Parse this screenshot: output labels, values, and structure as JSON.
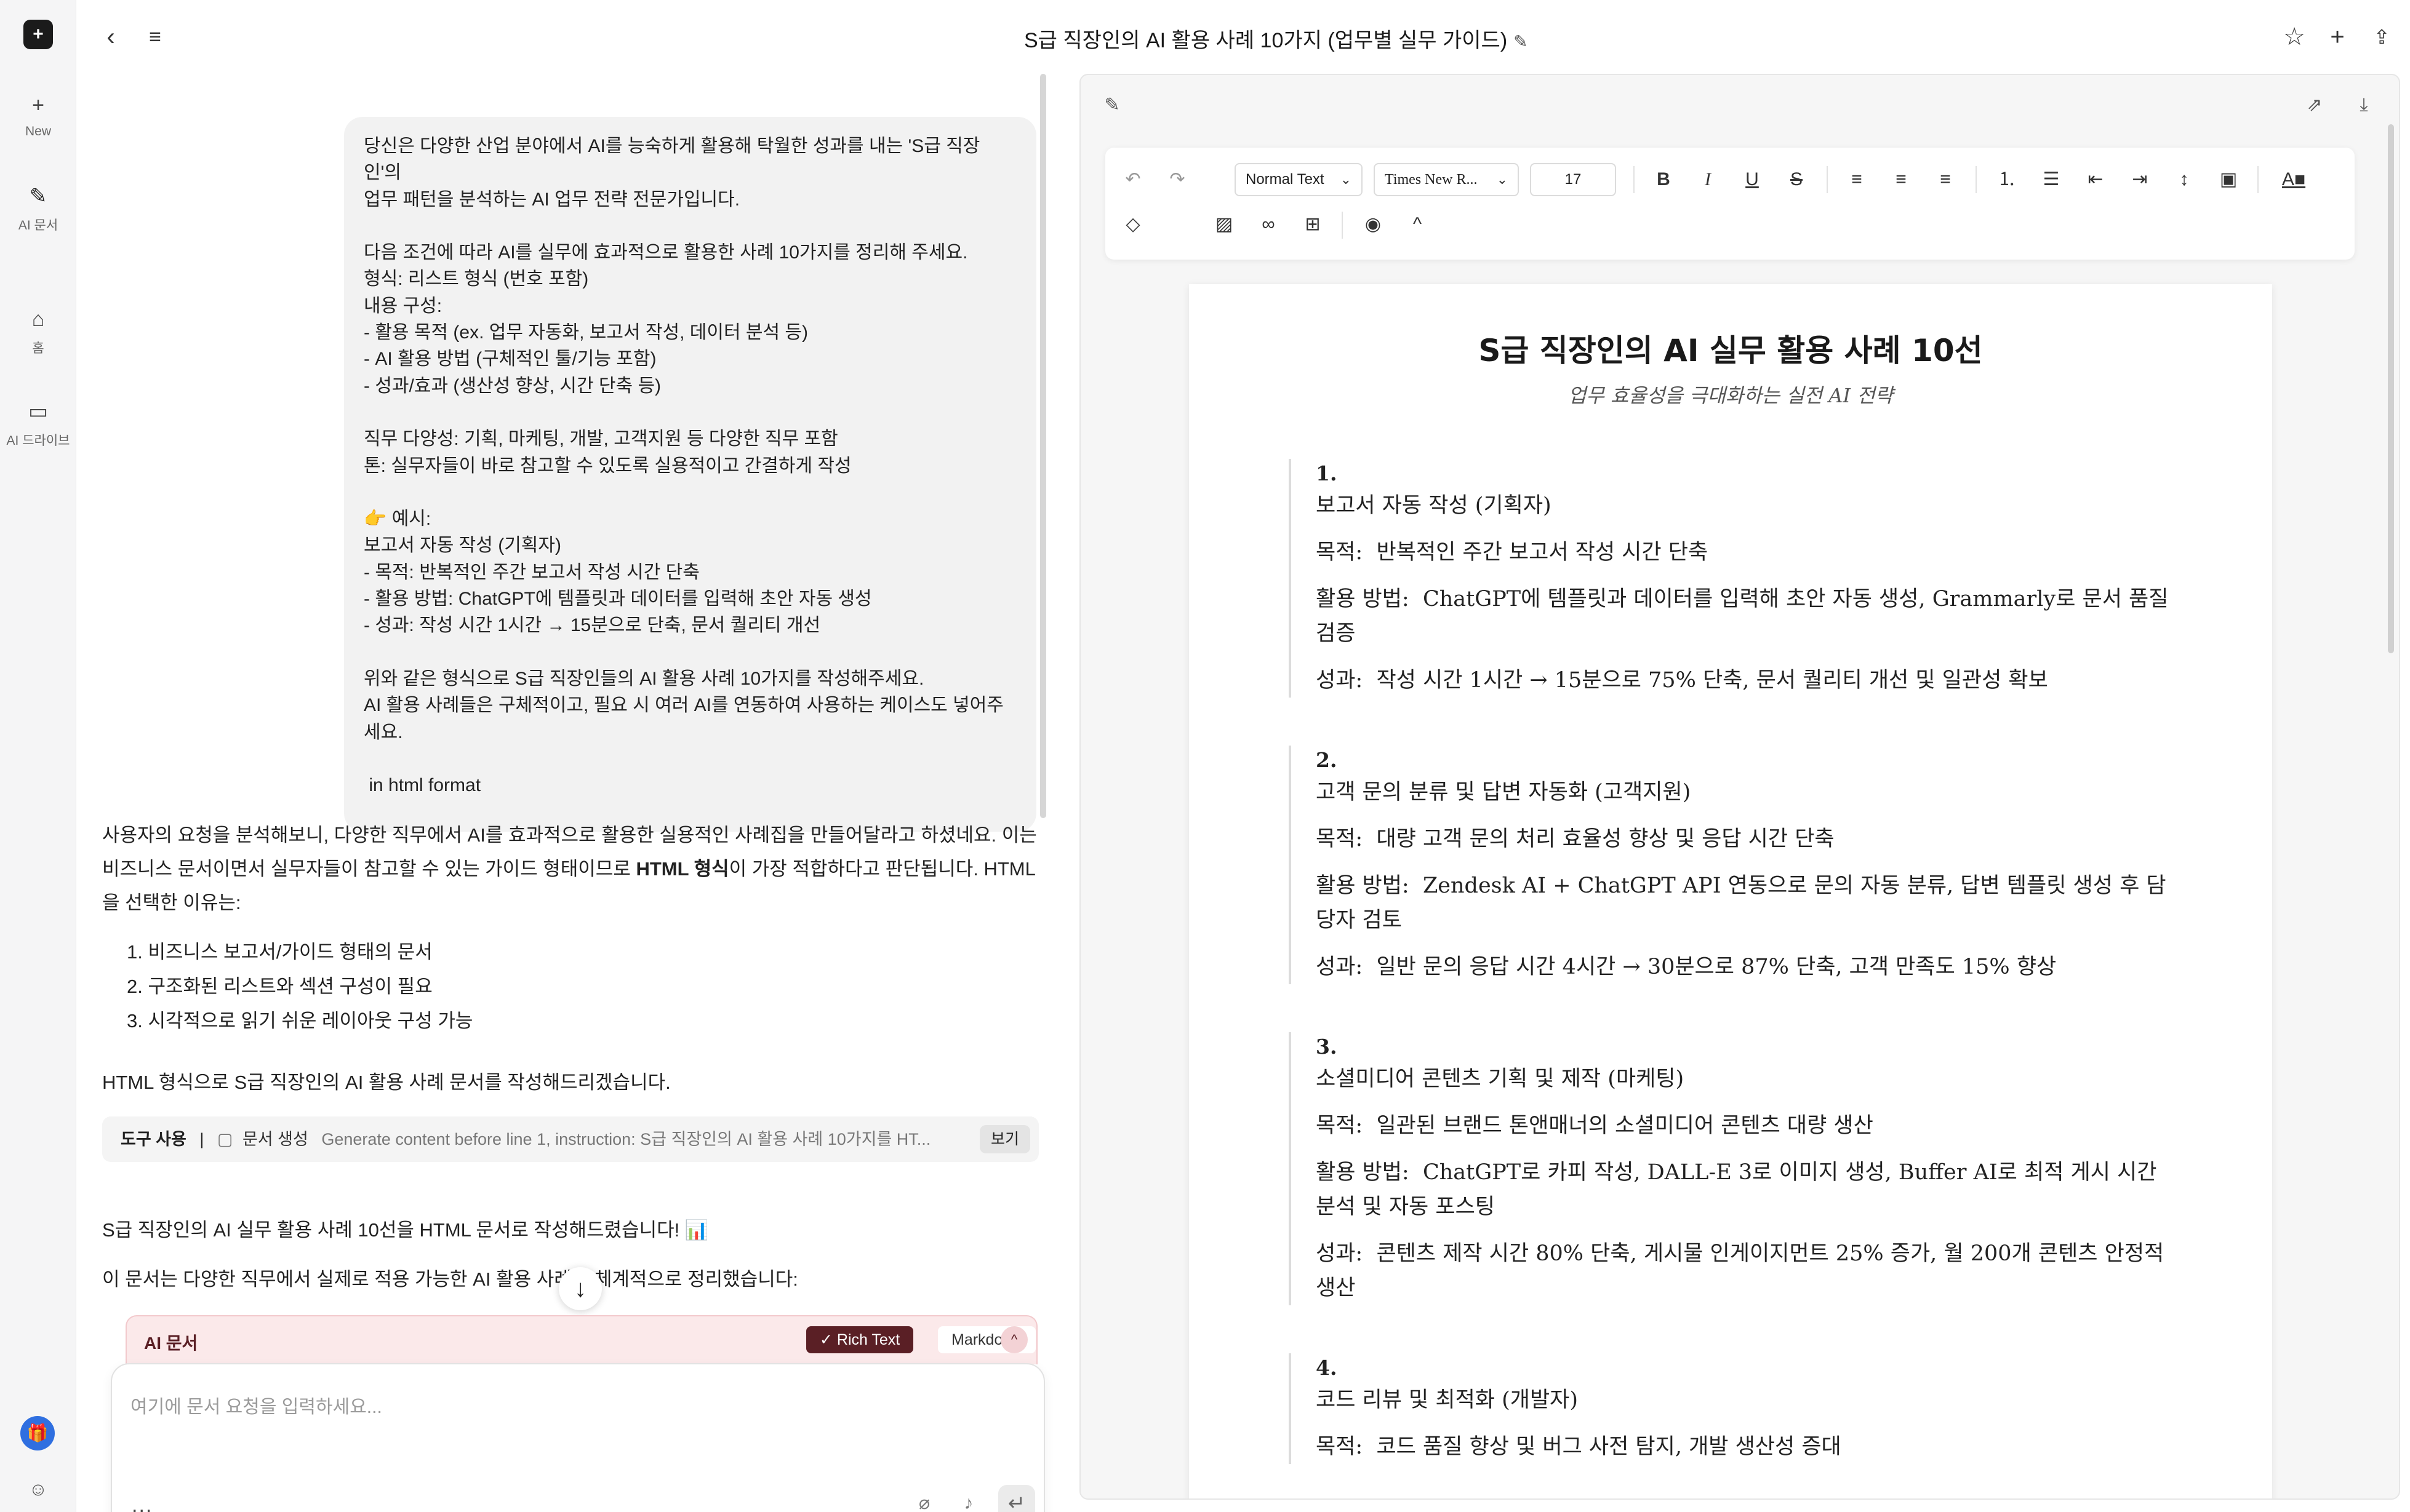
{
  "rail": {
    "new_label": "New",
    "ai_doc_label": "AI 문서",
    "home_label": "홈",
    "ai_drive_label": "AI 드라이브"
  },
  "header": {
    "title": "S급 직장인의 AI 활용 사례 10가지 (업무별 실무 가이드)"
  },
  "chat": {
    "user_message": "당신은 다양한 산업 분야에서 AI를 능숙하게 활용해 탁월한 성과를 내는 'S급 직장인'의\n업무 패턴을 분석하는 AI 업무 전략 전문가입니다.\n\n다음 조건에 따라 AI를 실무에 효과적으로 활용한 사례 10가지를 정리해 주세요.\n형식: 리스트 형식 (번호 포함)\n내용 구성:\n- 활용 목적 (ex. 업무 자동화, 보고서 작성, 데이터 분석 등)\n- AI 활용 방법 (구체적인 툴/기능 포함)\n- 성과/효과 (생산성 향상, 시간 단축 등)\n\n직무 다양성: 기획, 마케팅, 개발, 고객지원 등 다양한 직무 포함\n톤: 실무자들이 바로 참고할 수 있도록 실용적이고 간결하게 작성\n\n👉 예시:\n보고서 자동 작성 (기획자)\n- 목적: 반복적인 주간 보고서 작성 시간 단축\n- 활용 방법: ChatGPT에 템플릿과 데이터를 입력해 초안 자동 생성\n- 성과: 작성 시간 1시간 → 15분으로 단축, 문서 퀄리티 개선\n\n위와 같은 형식으로 S급 직장인들의 AI 활용 사례 10가지를 작성해주세요.\nAI 활용 사례들은 구체적이고, 필요 시 여러 AI를 연동하여 사용하는 케이스도 넣어주\n세요.\n\n in html format",
    "assistant_p1a": "사용자의 요청을 분석해보니, 다양한 직무에서 AI를 효과적으로 활용한 실용적인 사례집을 만들어달라고 하셨네요. 이는 비즈니스 문서이면서 실무자들이 참고할 수 있는 가이드 형태이므로 ",
    "assistant_p1_bold": "HTML 형식",
    "assistant_p1b": "이 가장 적합하다고 판단됩니다. HTML을 선택한 이유는:",
    "reasons": [
      "1. 비즈니스 보고서/가이드 형태의 문서",
      "2. 구조화된 리스트와 섹션 구성이 필요",
      "3. 시각적으로 읽기 쉬운 레이아웃 구성 가능"
    ],
    "assistant_p2": "HTML 형식으로 S급 직장인의 AI 활용 사례 문서를 작성해드리겠습니다.",
    "tool_use_label": "도구 사용",
    "tool_sep": "|",
    "tool_action": "문서 생성",
    "tool_instruction": "Generate content before line 1, instruction: S급 직장인의 AI 활용 사례 10가지를 HT...",
    "tool_view_label": "보기",
    "assistant_p3": "S급 직장인의 AI 실무 활용 사례 10선을 HTML 문서로 작성해드렸습니다! 📊",
    "assistant_p4": "이 문서는 다양한 직무에서 실제로 적용 가능한 AI 활용 사례를 체계적으로 정리했습니다:",
    "aidoc_title": "AI 문서",
    "mode_rich": "✓  Rich Text",
    "mode_markdown": "Markdown",
    "composer_placeholder": "여기에 문서 요청을 입력하세요...",
    "composer_more": "..."
  },
  "editor": {
    "style_select": "Normal Text",
    "font_select": "Times New R...",
    "font_size": "17",
    "doc_title": "S급 직장인의 AI 실무 활용 사례 10선",
    "doc_subtitle": "업무 효율성을 극대화하는 실전 AI 전략",
    "cases": [
      {
        "num": "1.",
        "title": "보고서 자동 작성 (기획자)",
        "purpose_k": "목적:",
        "purpose": "반복적인 주간 보고서 작성 시간 단축",
        "method_k": "활용 방법:",
        "method": "ChatGPT에 템플릿과 데이터를 입력해 초안 자동 생성, Grammarly로 문서 품질 검증",
        "result_k": "성과:",
        "result": "작성 시간 1시간 → 15분으로 75% 단축, 문서 퀄리티 개선 및 일관성 확보"
      },
      {
        "num": "2.",
        "title": "고객 문의 분류 및 답변 자동화 (고객지원)",
        "purpose_k": "목적:",
        "purpose": "대량 고객 문의 처리 효율성 향상 및 응답 시간 단축",
        "method_k": "활용 방법:",
        "method": "Zendesk AI + ChatGPT API 연동으로 문의 자동 분류, 답변 템플릿 생성 후 담당자 검토",
        "result_k": "성과:",
        "result": "일반 문의 응답 시간 4시간 → 30분으로 87% 단축, 고객 만족도 15% 향상"
      },
      {
        "num": "3.",
        "title": "소셜미디어 콘텐츠 기획 및 제작 (마케팅)",
        "purpose_k": "목적:",
        "purpose": "일관된 브랜드 톤앤매너의 소셜미디어 콘텐츠 대량 생산",
        "method_k": "활용 방법:",
        "method": "ChatGPT로 카피 작성, DALL-E 3로 이미지 생성, Buffer AI로 최적 게시 시간 분석 및 자동 포스팅",
        "result_k": "성과:",
        "result": "콘텐츠 제작 시간 80% 단축, 게시물 인게이지먼트 25% 증가, 월 200개 콘텐츠 안정적 생산"
      },
      {
        "num": "4.",
        "title": "코드 리뷰 및 최적화 (개발자)",
        "purpose_k": "목적:",
        "purpose": "코드 품질 향상 및 버그 사전 탐지, 개발 생산성 증대",
        "method_k": "",
        "method": "",
        "result_k": "",
        "result": ""
      }
    ]
  }
}
